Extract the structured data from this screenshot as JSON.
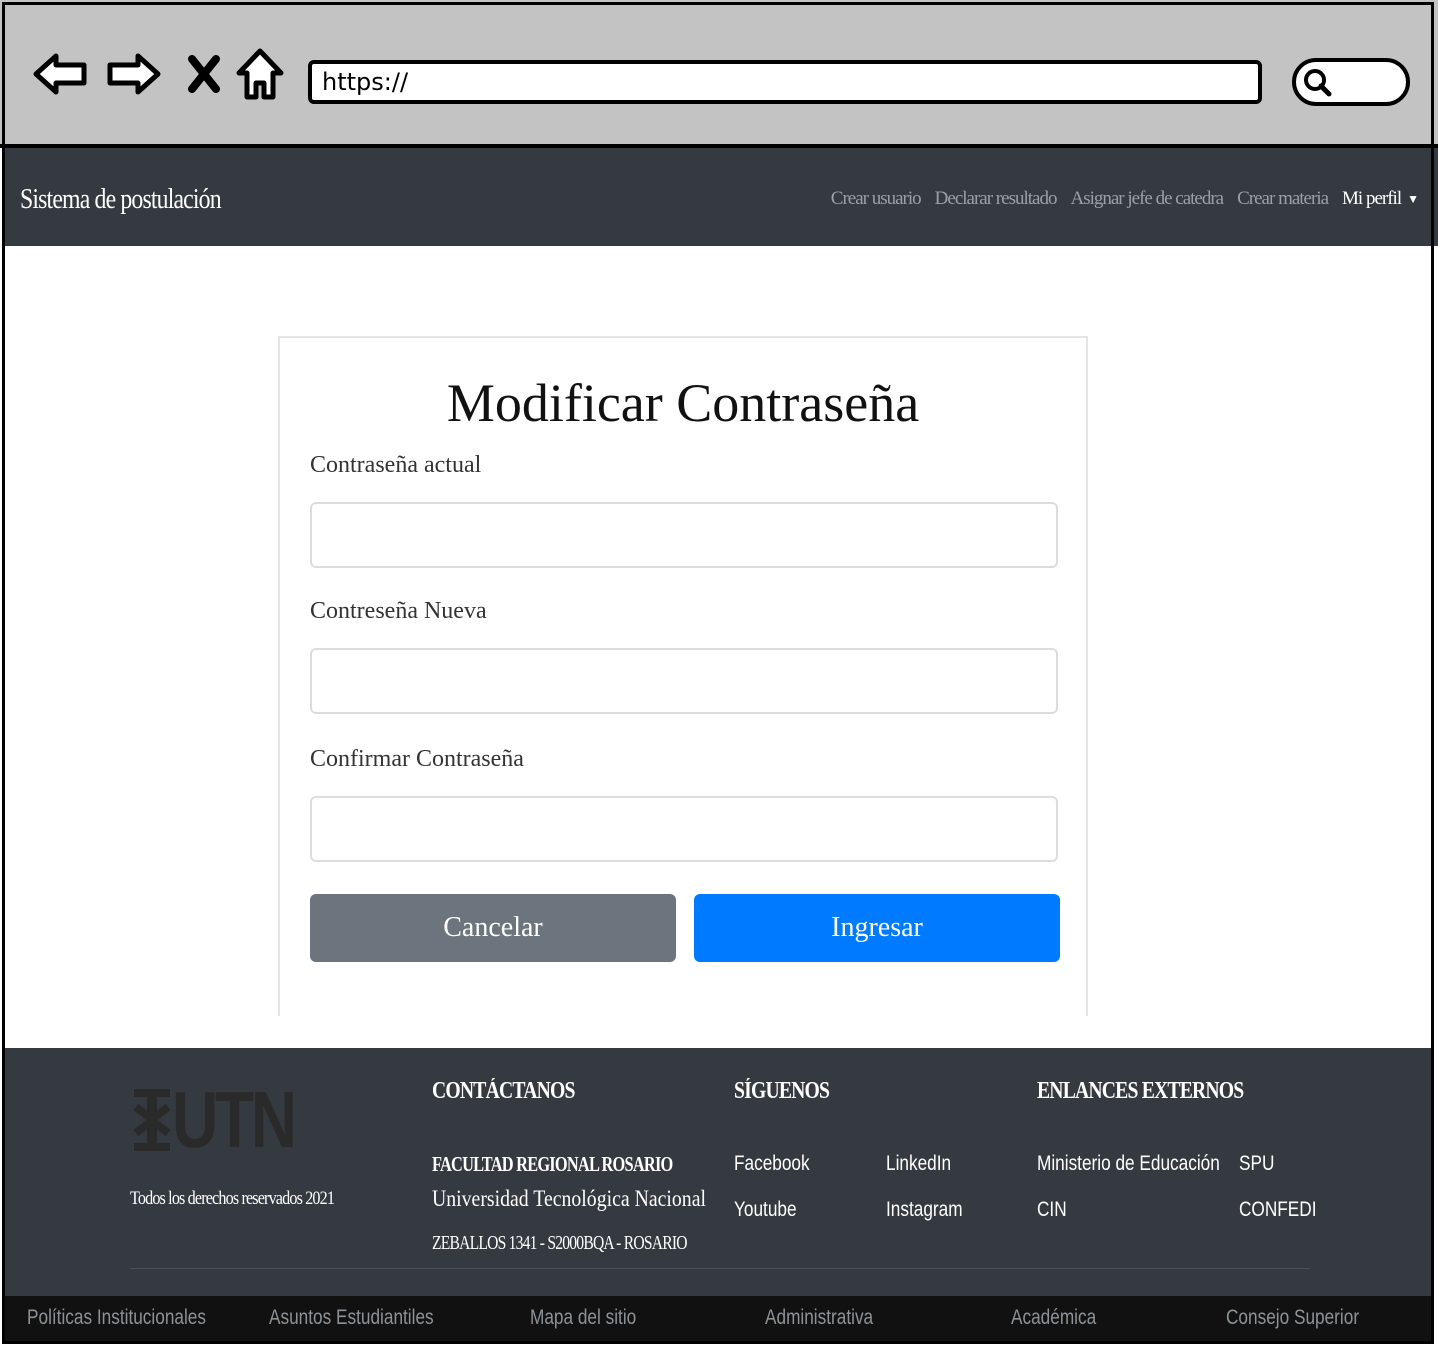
{
  "browser": {
    "url": "https://"
  },
  "navbar": {
    "brand": "Sistema de postulación",
    "links": [
      {
        "label": "Crear usuario"
      },
      {
        "label": "Declarar resultado"
      },
      {
        "label": "Asignar jefe de catedra"
      },
      {
        "label": "Crear materia"
      },
      {
        "label": "Mi perfil"
      }
    ]
  },
  "form": {
    "title": "Modificar Contraseña",
    "fields": [
      {
        "label": "Contraseña actual",
        "value": ""
      },
      {
        "label": "Contreseña Nueva",
        "value": ""
      },
      {
        "label": "Confirmar Contraseña",
        "value": ""
      }
    ],
    "cancel_label": "Cancelar",
    "submit_label": "Ingresar"
  },
  "footer": {
    "logo_text": "UTN",
    "rights": "Todos los derechos reservados 2021",
    "contact": {
      "heading": "CONTÁCTANOS",
      "faculty": "FACULTAD REGIONAL ROSARIO",
      "university": "Universidad Tecnológica Nacional",
      "address": "ZEBALLOS 1341 - S2000BQA - ROSARIO"
    },
    "social": {
      "heading": "SÍGUENOS",
      "links": [
        "Facebook",
        "LinkedIn",
        "Youtube",
        "Instagram"
      ]
    },
    "external": {
      "heading": "ENLANCES EXTERNOS",
      "links": [
        "Ministerio de Educación",
        "SPU",
        "CIN",
        "CONFEDI"
      ]
    },
    "bottom_links": [
      "Políticas Institucionales",
      "Asuntos Estudiantiles",
      "Mapa del sitio",
      "Administrativa",
      "Académica",
      "Consejo Superior"
    ]
  }
}
